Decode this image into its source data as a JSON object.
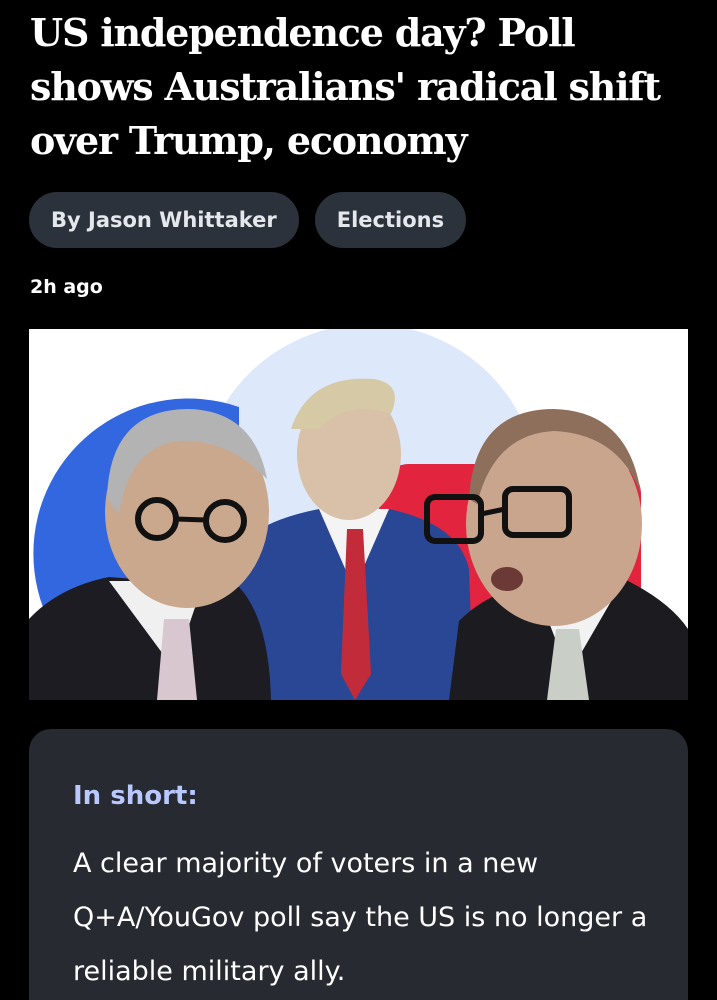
{
  "article": {
    "headline": "US independence day? Poll shows Australians' radical shift over Trump, economy",
    "byline": "By Jason Whittaker",
    "topic": "Elections",
    "published": "2h ago"
  },
  "hero_image": {
    "colors": {
      "background": "#ffffff",
      "circle": "#dde9fb",
      "left_shape": "#3367e0",
      "right_shape": "#e3243e",
      "suit_blue": "#2a4796",
      "tie_red": "#c22c3a"
    }
  },
  "summary": {
    "heading": "In short:",
    "text": "A clear majority of voters in a new Q+A/YouGov poll say the US is no longer a reliable military ally."
  },
  "colors": {
    "page_background": "#000000",
    "chip_background": "#2c323b",
    "summary_background": "#272a31",
    "summary_heading": "#b9c8ff"
  }
}
